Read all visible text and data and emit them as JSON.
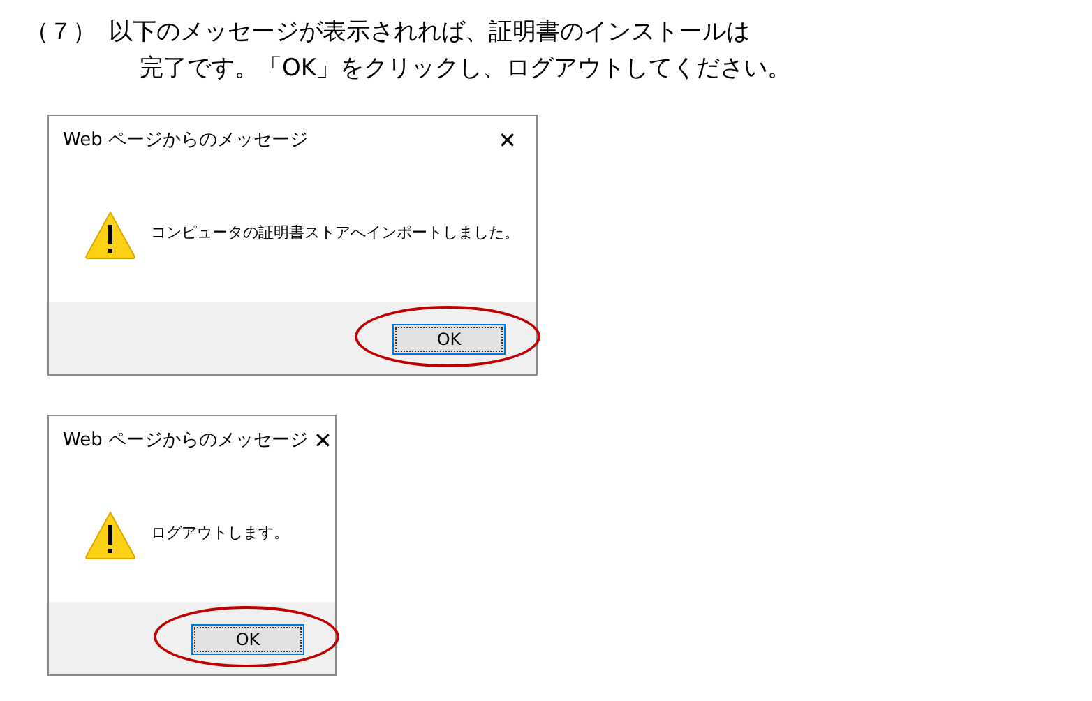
{
  "instruction": {
    "step": "（７）",
    "lines": [
      "以下のメッセージが表示されれば、証明書のインストールは",
      "完了です。「OK」をクリックし、ログアウトしてください。"
    ]
  },
  "dialogs": [
    {
      "title": "Web ページからのメッセージ",
      "close": "✕",
      "message": "コンピュータの証明書ストアへインポートしました。",
      "button": {
        "label": "OK",
        "highlighted": true
      }
    },
    {
      "title": "Web ページからのメッセージ",
      "close": "✕",
      "message": "ログアウトします。",
      "button": {
        "label": "OK",
        "highlighted": true
      }
    }
  ]
}
